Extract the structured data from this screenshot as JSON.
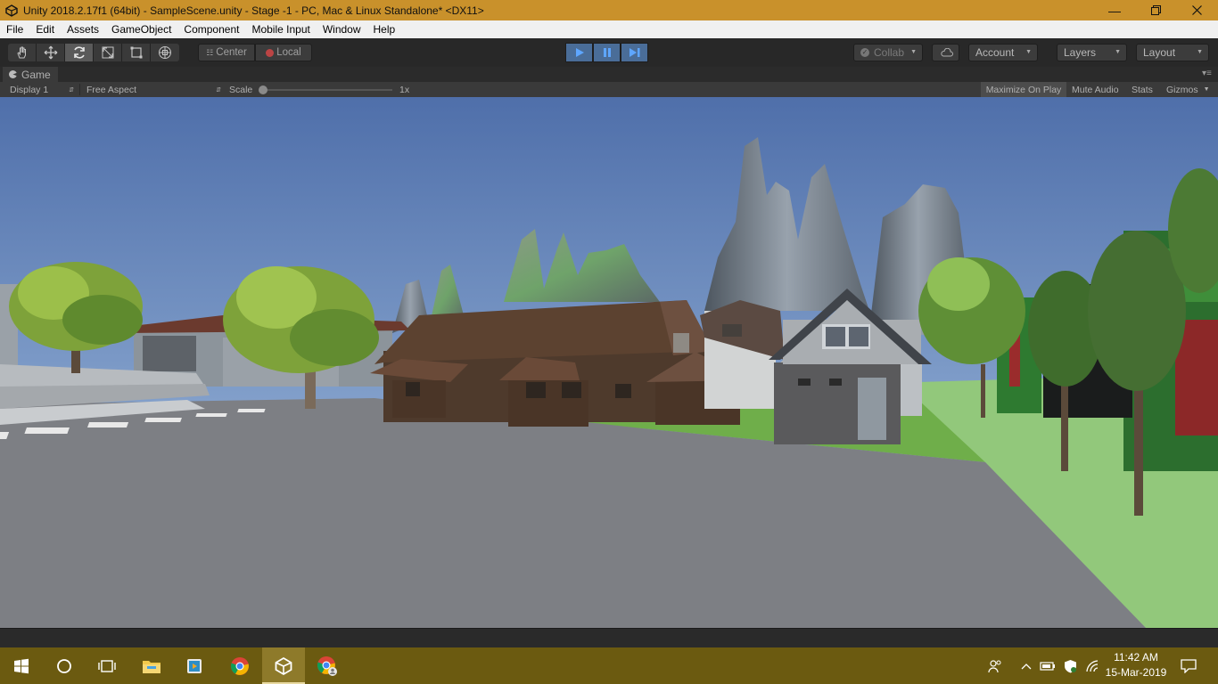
{
  "window": {
    "title": "Unity 2018.2.17f1 (64bit) - SampleScene.unity - Stage -1 - PC, Mac & Linux Standalone* <DX11>",
    "controls": [
      "minimize-icon",
      "restore-icon",
      "close-icon"
    ]
  },
  "menu": [
    "File",
    "Edit",
    "Assets",
    "GameObject",
    "Component",
    "Mobile Input",
    "Window",
    "Help"
  ],
  "toolbar": {
    "tools": [
      "hand-icon",
      "move-icon",
      "rotate-icon",
      "scale-icon",
      "rect-icon",
      "transform-icon"
    ],
    "active_tool": "rotate-icon",
    "pivot_label": "Center",
    "space_label": "Local",
    "collab_label": "Collab",
    "account_label": "Account",
    "layers_label": "Layers",
    "layout_label": "Layout",
    "accent": "#4a6d98"
  },
  "game_view": {
    "tab_label": "Game",
    "display": "Display 1",
    "aspect": "Free Aspect",
    "scale_label": "Scale",
    "scale_value": "1x",
    "maximize_on_play": "Maximize On Play",
    "mute_audio": "Mute Audio",
    "stats": "Stats",
    "gizmos": "Gizmos"
  },
  "taskbar": {
    "apps": [
      "windows-start-icon",
      "cortana-icon",
      "task-view-icon",
      "file-explorer-icon",
      "media-player-icon",
      "chrome-icon",
      "unity-icon",
      "chrome-profile-icon"
    ],
    "active_app": "unity-icon",
    "time": "11:42 AM",
    "date": "15-Mar-2019"
  }
}
